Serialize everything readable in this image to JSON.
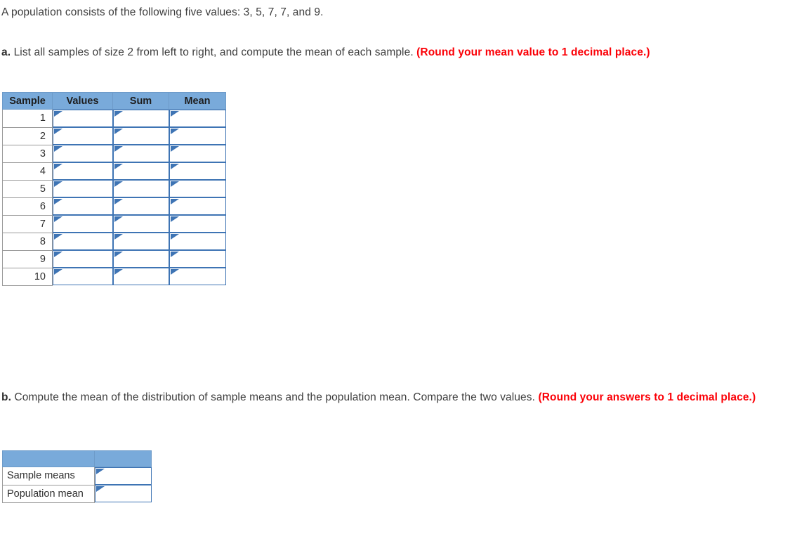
{
  "question": {
    "intro": "A population consists of the following five values: 3, 5, 7, 7, and 9.",
    "part_a": {
      "label": "a.",
      "text": "List all samples of size 2 from left to right, and compute the mean of each sample.",
      "note": "(Round your mean value to 1 decimal place.)"
    },
    "part_b": {
      "label": "b.",
      "text": "Compute the mean of the distribution of sample means and the population mean. Compare the two values.",
      "note": "(Round your answers to 1 decimal place.)"
    }
  },
  "sample_table": {
    "headers": [
      "Sample",
      "Values",
      "Sum",
      "Mean"
    ],
    "rows": [
      {
        "sample": "1",
        "values": "",
        "sum": "",
        "mean": ""
      },
      {
        "sample": "2",
        "values": "",
        "sum": "",
        "mean": ""
      },
      {
        "sample": "3",
        "values": "",
        "sum": "",
        "mean": ""
      },
      {
        "sample": "4",
        "values": "",
        "sum": "",
        "mean": ""
      },
      {
        "sample": "5",
        "values": "",
        "sum": "",
        "mean": ""
      },
      {
        "sample": "6",
        "values": "",
        "sum": "",
        "mean": ""
      },
      {
        "sample": "7",
        "values": "",
        "sum": "",
        "mean": ""
      },
      {
        "sample": "8",
        "values": "",
        "sum": "",
        "mean": ""
      },
      {
        "sample": "9",
        "values": "",
        "sum": "",
        "mean": ""
      },
      {
        "sample": "10",
        "values": "",
        "sum": "",
        "mean": ""
      }
    ]
  },
  "means_table": {
    "headers": [
      "",
      ""
    ],
    "rows": [
      {
        "label": "Sample means",
        "value": ""
      },
      {
        "label": "Population mean",
        "value": ""
      }
    ]
  },
  "colors": {
    "header_blue": "#79aada",
    "input_border_blue": "#3e74b4",
    "note_red": "#fb0007",
    "grid_gray": "#9a9a9a",
    "text_gray": "#3d3d3d"
  },
  "icons": {
    "input_marker": "triangle-marker-icon"
  }
}
